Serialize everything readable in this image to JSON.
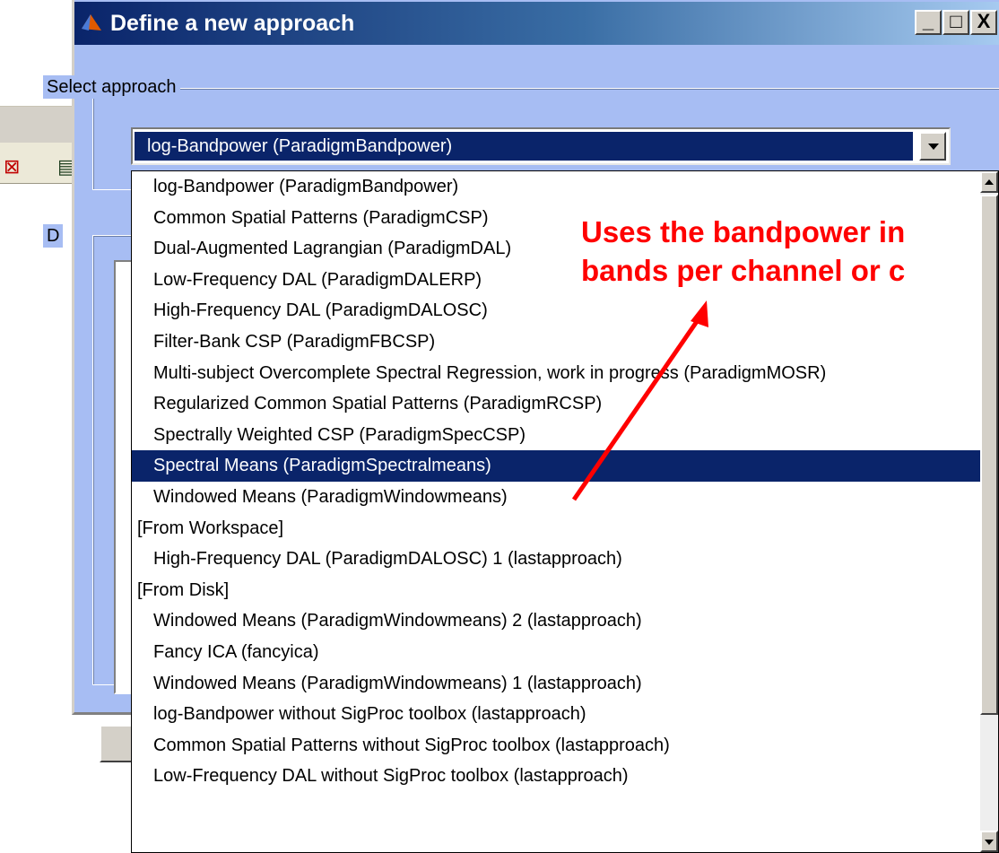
{
  "dialog": {
    "title": "Define a new approach",
    "icon": "matlab-icon",
    "window_buttons": [
      "minimize-icon",
      "maximize-icon",
      "close-icon"
    ],
    "minimize_glyph": "_",
    "maximize_glyph": "□",
    "close_glyph": "X",
    "select_group_label": "Select approach",
    "description_group_label": "D",
    "selected_value": "log-Bandpower (ParadigmBandpower)"
  },
  "dropdown": {
    "highlighted_index": 9,
    "options": [
      {
        "label": "log-Bandpower (ParadigmBandpower)",
        "section": false
      },
      {
        "label": "Common Spatial Patterns (ParadigmCSP)",
        "section": false
      },
      {
        "label": "Dual-Augmented Lagrangian (ParadigmDAL)",
        "section": false
      },
      {
        "label": "Low-Frequency DAL (ParadigmDALERP)",
        "section": false
      },
      {
        "label": "High-Frequency DAL (ParadigmDALOSC)",
        "section": false
      },
      {
        "label": "Filter-Bank CSP (ParadigmFBCSP)",
        "section": false
      },
      {
        "label": "Multi-subject Overcomplete Spectral Regression, work in progress (ParadigmMOSR)",
        "section": false
      },
      {
        "label": "Regularized Common Spatial Patterns (ParadigmRCSP)",
        "section": false
      },
      {
        "label": "Spectrally Weighted CSP (ParadigmSpecCSP)",
        "section": false
      },
      {
        "label": "Spectral Means (ParadigmSpectralmeans)",
        "section": false
      },
      {
        "label": "Windowed Means (ParadigmWindowmeans)",
        "section": false
      },
      {
        "label": "[From Workspace]",
        "section": true
      },
      {
        "label": "High-Frequency DAL (ParadigmDALOSC) 1 (lastapproach)",
        "section": false
      },
      {
        "label": "[From Disk]",
        "section": true
      },
      {
        "label": "Windowed Means (ParadigmWindowmeans) 2 (lastapproach)",
        "section": false
      },
      {
        "label": "Fancy ICA (fancyica)",
        "section": false
      },
      {
        "label": "Windowed Means (ParadigmWindowmeans) 1 (lastapproach)",
        "section": false
      },
      {
        "label": "log-Bandpower without SigProc toolbox (lastapproach)",
        "section": false
      },
      {
        "label": "Common Spatial Patterns without SigProc toolbox (lastapproach)",
        "section": false
      },
      {
        "label": "Low-Frequency DAL without SigProc toolbox (lastapproach)",
        "section": false
      }
    ]
  },
  "annotation": {
    "line1": "Uses the bandpower in",
    "line2": "bands per channel or c",
    "color": "#ff0000"
  },
  "colors": {
    "dialog_background": "#a7bdf3",
    "selection": "#0a246a",
    "titlebar_start": "#0a246a"
  }
}
